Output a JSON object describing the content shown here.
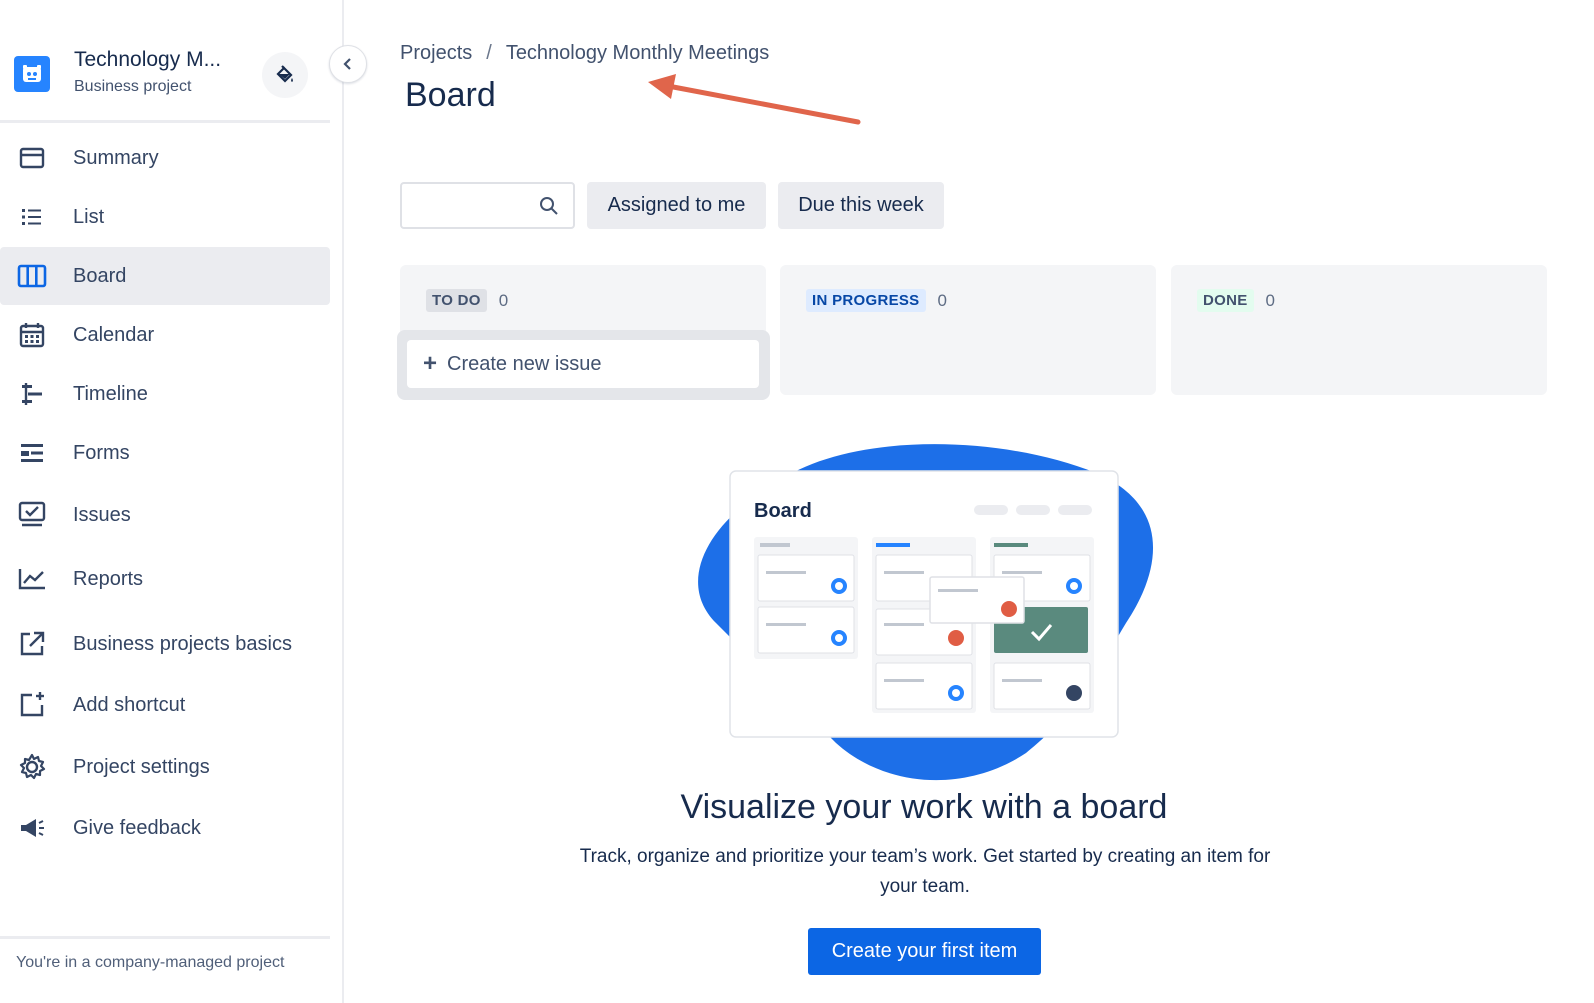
{
  "project": {
    "name": "Technology M...",
    "type": "Business project"
  },
  "sidebar": {
    "items": [
      {
        "label": "Summary",
        "icon": "summary-icon"
      },
      {
        "label": "List",
        "icon": "list-icon"
      },
      {
        "label": "Board",
        "icon": "board-icon",
        "active": true
      },
      {
        "label": "Calendar",
        "icon": "calendar-icon"
      },
      {
        "label": "Timeline",
        "icon": "timeline-icon"
      },
      {
        "label": "Forms",
        "icon": "forms-icon"
      },
      {
        "label": "Issues",
        "icon": "issues-icon"
      },
      {
        "label": "Reports",
        "icon": "reports-icon"
      },
      {
        "label": "Business projects basics",
        "icon": "external-link-icon"
      },
      {
        "label": "Add shortcut",
        "icon": "add-shortcut-icon"
      },
      {
        "label": "Project settings",
        "icon": "gear-icon"
      },
      {
        "label": "Give feedback",
        "icon": "megaphone-icon"
      }
    ],
    "footer": "You're in a company-managed project"
  },
  "breadcrumb": {
    "root": "Projects",
    "separator": "/",
    "current": "Technology Monthly Meetings"
  },
  "page_title": "Board",
  "filters": {
    "search_placeholder": "",
    "assigned": "Assigned to me",
    "due": "Due this week"
  },
  "columns": [
    {
      "name": "TO DO",
      "count": "0",
      "color": "#42526e",
      "bg": "#dfe1e6"
    },
    {
      "name": "IN PROGRESS",
      "count": "0",
      "color": "#0747a6",
      "bg": "#deebff"
    },
    {
      "name": "DONE",
      "count": "0",
      "color": "#42526e",
      "bg": "#e3fcef"
    }
  ],
  "create_issue": "Create new issue",
  "illustration": {
    "board_label": "Board"
  },
  "empty_state": {
    "title": "Visualize your work with a board",
    "description": "Track, organize and prioritize your team’s work. Get started by creating an item for your team.",
    "cta": "Create your first item"
  },
  "colors": {
    "accent": "#0c66e4",
    "blob": "#1d6fe8",
    "annotation_arrow": "#e0654b",
    "done_card": "#5a8a7e"
  }
}
